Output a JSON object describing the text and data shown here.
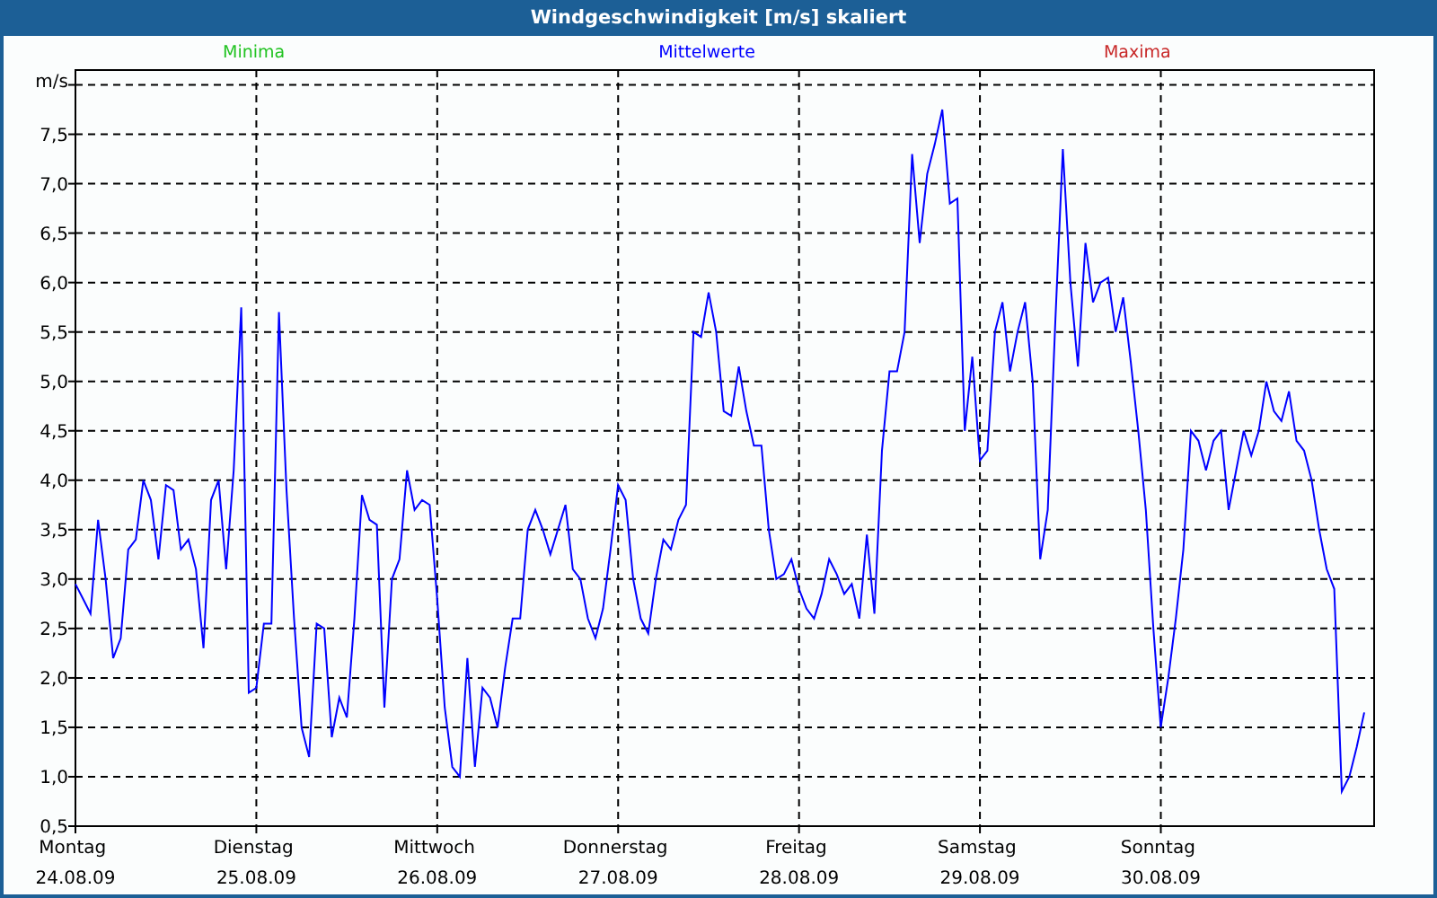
{
  "window": {
    "title": "Windgeschwindigkeit [m/s] skaliert"
  },
  "legend": [
    {
      "label": "Minima",
      "color": "#22c322"
    },
    {
      "label": "Maxima",
      "color": "#c82828"
    }
  ],
  "chart": {
    "chart_data": {
      "type": "line",
      "ylabel": "m/s",
      "grid": true,
      "ylim": [
        0.5,
        8.15
      ],
      "yticks": [
        {
          "value": 0.5,
          "label": "0,5"
        },
        {
          "value": 1,
          "label": "1,0"
        },
        {
          "value": 1.5,
          "label": "1,5"
        },
        {
          "value": 2,
          "label": "2,0"
        },
        {
          "value": 2.5,
          "label": "2,5"
        },
        {
          "value": 3,
          "label": "3,0"
        },
        {
          "value": 3.5,
          "label": "3,5"
        },
        {
          "value": 4,
          "label": "4,0"
        },
        {
          "value": 4.5,
          "label": "4,5"
        },
        {
          "value": 5,
          "label": "5,0"
        },
        {
          "value": 5.5,
          "label": "5,5"
        },
        {
          "value": 6,
          "label": "6,0"
        },
        {
          "value": 6.5,
          "label": "6,5"
        },
        {
          "value": 7,
          "label": "7,0"
        },
        {
          "value": 7.5,
          "label": "7,5"
        }
      ],
      "categories": [
        "Montag 24.08.09",
        null,
        null,
        null,
        null,
        null,
        null,
        null,
        null,
        null,
        null,
        null,
        null,
        null,
        null,
        null,
        null,
        null,
        null,
        null,
        null,
        null,
        null,
        null,
        "Dienstag 25.08.09",
        null,
        null,
        null,
        null,
        null,
        null,
        null,
        null,
        null,
        null,
        null,
        null,
        null,
        null,
        null,
        null,
        null,
        null,
        null,
        null,
        null,
        null,
        null,
        "Mittwoch 26.08.09",
        null,
        null,
        null,
        null,
        null,
        null,
        null,
        null,
        null,
        null,
        null,
        null,
        null,
        null,
        null,
        null,
        null,
        null,
        null,
        null,
        null,
        null,
        null,
        "Donnerstag 27.08.09",
        null,
        null,
        null,
        null,
        null,
        null,
        null,
        null,
        null,
        null,
        null,
        null,
        null,
        null,
        null,
        null,
        null,
        null,
        null,
        null,
        null,
        null,
        null,
        "Freitag 28.08.09",
        null,
        null,
        null,
        null,
        null,
        null,
        null,
        null,
        null,
        null,
        null,
        null,
        null,
        null,
        null,
        null,
        null,
        null,
        null,
        null,
        null,
        null,
        null,
        "Samstag 29.08.09",
        null,
        null,
        null,
        null,
        null,
        null,
        null,
        null,
        null,
        null,
        null,
        null,
        null,
        null,
        null,
        null,
        null,
        null,
        null,
        null,
        null,
        null,
        null,
        "Sonntag 30.08.09",
        null,
        null,
        null,
        null,
        null,
        null,
        null,
        null,
        null,
        null,
        null,
        null,
        null,
        null,
        null,
        null,
        null,
        null,
        null,
        null,
        null,
        null,
        null,
        null,
        null,
        null,
        null
      ],
      "series": [
        {
          "name": "Mittelwerte",
          "color": "#0000ff",
          "values": [
            2.95,
            2.8,
            2.65,
            3.6,
            3.0,
            2.2,
            2.4,
            3.3,
            3.4,
            4.0,
            3.8,
            3.2,
            3.95,
            3.9,
            3.3,
            3.4,
            3.1,
            2.3,
            3.8,
            4.0,
            3.1,
            4.1,
            5.75,
            1.85,
            1.9,
            2.55,
            2.55,
            5.7,
            3.9,
            2.6,
            1.5,
            1.2,
            2.55,
            2.5,
            1.4,
            1.8,
            1.6,
            2.6,
            3.85,
            3.6,
            3.55,
            1.7,
            3.0,
            3.2,
            4.1,
            3.7,
            3.8,
            3.75,
            2.8,
            1.7,
            1.1,
            1.0,
            2.2,
            1.1,
            1.9,
            1.8,
            1.5,
            2.1,
            2.6,
            2.6,
            3.5,
            3.7,
            3.5,
            3.25,
            3.5,
            3.75,
            3.1,
            3.0,
            2.6,
            2.4,
            2.7,
            3.3,
            3.95,
            3.8,
            3.0,
            2.6,
            2.45,
            3.0,
            3.4,
            3.3,
            3.6,
            3.75,
            5.5,
            5.45,
            5.9,
            5.5,
            4.7,
            4.65,
            5.15,
            4.7,
            4.35,
            4.35,
            3.5,
            3.0,
            3.05,
            3.2,
            2.9,
            2.7,
            2.6,
            2.85,
            3.2,
            3.05,
            2.85,
            2.95,
            2.6,
            3.45,
            2.65,
            4.3,
            5.1,
            5.1,
            5.5,
            7.3,
            6.4,
            7.1,
            7.4,
            7.75,
            6.8,
            6.85,
            4.5,
            5.25,
            4.2,
            4.3,
            5.5,
            5.8,
            5.1,
            5.5,
            5.8,
            5.0,
            3.2,
            3.7,
            5.6,
            7.35,
            6.0,
            5.15,
            6.4,
            5.8,
            6.0,
            6.05,
            5.5,
            5.85,
            5.2,
            4.5,
            3.7,
            2.5,
            1.5,
            2.0,
            2.6,
            3.3,
            4.5,
            4.4,
            4.1,
            4.4,
            4.5,
            3.7,
            4.1,
            4.5,
            4.25,
            4.5,
            5.0,
            4.7,
            4.6,
            4.9,
            4.4,
            4.3,
            4.0,
            3.5,
            3.1,
            2.9,
            0.85,
            1.0,
            1.3,
            1.65
          ]
        }
      ]
    }
  }
}
